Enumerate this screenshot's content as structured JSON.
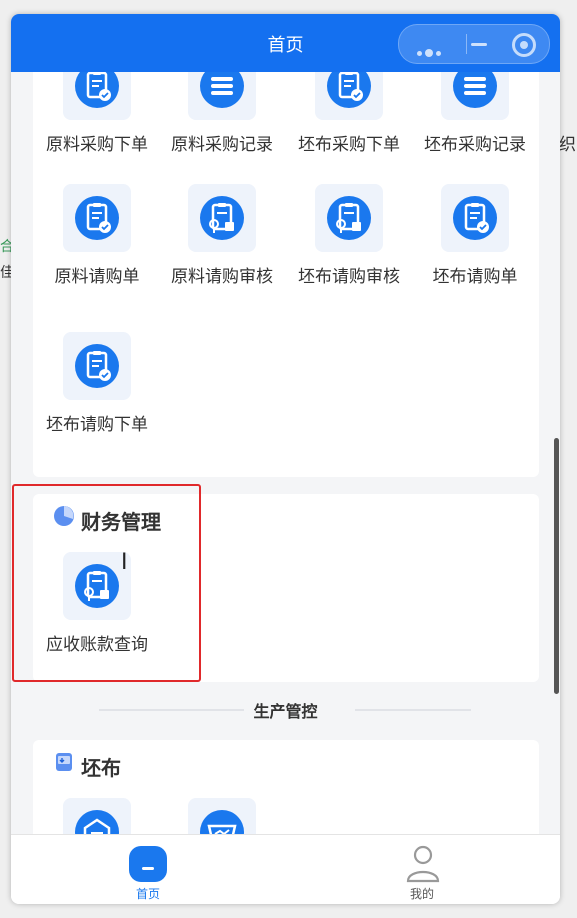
{
  "background": {
    "right_char": "织",
    "left_text_1": "合",
    "left_text_2": "佳"
  },
  "window": {
    "title": "首页"
  },
  "procurement": {
    "items": [
      {
        "label": "原料采购下单",
        "icon": "clipboard-check-icon"
      },
      {
        "label": "原料采购记录",
        "icon": "list-icon"
      },
      {
        "label": "坯布采购下单",
        "icon": "clipboard-check-icon"
      },
      {
        "label": "坯布采购记录",
        "icon": "list-icon"
      },
      {
        "label": "原料请购单",
        "icon": "clipboard-check-icon"
      },
      {
        "label": "原料请购审核",
        "icon": "clipboard-search-icon"
      },
      {
        "label": "坯布请购审核",
        "icon": "clipboard-search-icon"
      },
      {
        "label": "坯布请购单",
        "icon": "clipboard-check-icon"
      },
      {
        "label": "坯布请购下单",
        "icon": "clipboard-check-icon"
      }
    ]
  },
  "finance": {
    "title": "财务管理",
    "items": [
      {
        "label": "应收账款查询",
        "icon": "clipboard-search-icon"
      }
    ]
  },
  "divider": {
    "label": "生产管控"
  },
  "greige": {
    "title": "坯布",
    "items": [
      {
        "label": "",
        "icon": "warehouse-icon"
      },
      {
        "label": "",
        "icon": "truck-icon"
      }
    ]
  },
  "tabbar": {
    "home_label": "首页",
    "mine_label": "我的"
  },
  "colors": {
    "brand": "#1470f0",
    "icon_blue": "#1a78ee",
    "highlight": "#e0292b"
  }
}
